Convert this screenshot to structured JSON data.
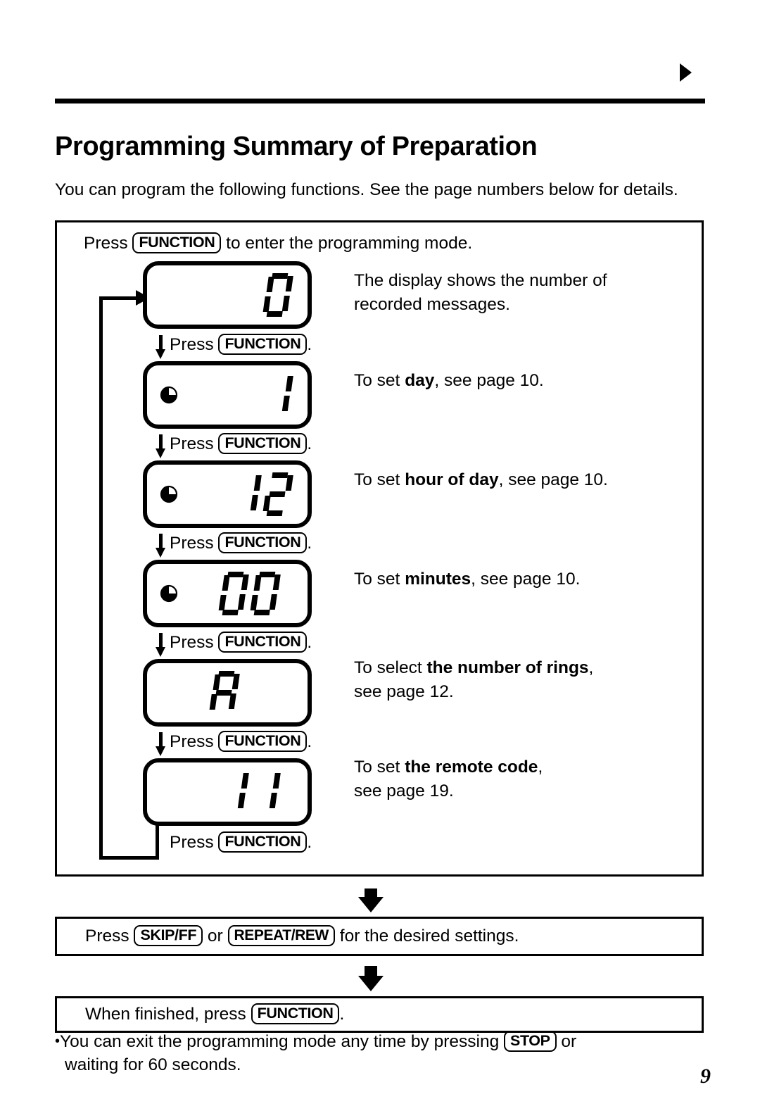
{
  "page": {
    "title": "Programming Summary of Preparation",
    "intro": "You can program the following functions. See the page numbers below for details.",
    "number": "9",
    "marker_icon": "right-triangle-icon"
  },
  "keys": {
    "function": "FUNCTION",
    "skip_ff": "SKIP/FF",
    "repeat_rew": "REPEAT/REW",
    "stop": "STOP"
  },
  "flow": {
    "intro_before": "Press",
    "intro_after": "to enter the programming mode.",
    "press_label": "Press",
    "press_period": ".",
    "steps": [
      {
        "display": {
          "clock_icon": false,
          "digits": [
            "0"
          ],
          "value": "0"
        },
        "description_plain_1": "The display shows the number of",
        "description_plain_2": "recorded messages.",
        "description_prefix": "",
        "description_bold": "",
        "description_suffix": ""
      },
      {
        "display": {
          "clock_icon": true,
          "digits": [
            "1"
          ],
          "value": "1"
        },
        "description_prefix": "To set ",
        "description_bold": "day",
        "description_suffix": ", see page 10."
      },
      {
        "display": {
          "clock_icon": true,
          "digits": [
            "1",
            "2"
          ],
          "value": "12"
        },
        "description_prefix": "To set ",
        "description_bold": "hour of day",
        "description_suffix": ", see page 10."
      },
      {
        "display": {
          "clock_icon": true,
          "digits": [
            "0",
            "0"
          ],
          "value": "00"
        },
        "description_prefix": "To set ",
        "description_bold": "minutes",
        "description_suffix": ", see page 10."
      },
      {
        "display": {
          "clock_icon": false,
          "digits": [
            "A"
          ],
          "value": "A"
        },
        "description_prefix": "To select ",
        "description_bold": "the number of rings",
        "description_suffix": ",",
        "description_line2": "see page 12."
      },
      {
        "display": {
          "clock_icon": false,
          "digits": [
            "1",
            "1"
          ],
          "value": "11"
        },
        "description_prefix": "To set ",
        "description_bold": "the remote code",
        "description_suffix": ",",
        "description_line2": "see page 19."
      }
    ]
  },
  "bottom": {
    "settings_box": {
      "before": "Press",
      "middle": "or",
      "after": "for the desired settings."
    },
    "finish_box": {
      "before": "When finished, press",
      "after": "."
    }
  },
  "note": {
    "bullet": "•",
    "line1_before": "You can exit the programming mode any time by pressing",
    "line1_after": "or",
    "line2": "waiting for 60 seconds."
  }
}
